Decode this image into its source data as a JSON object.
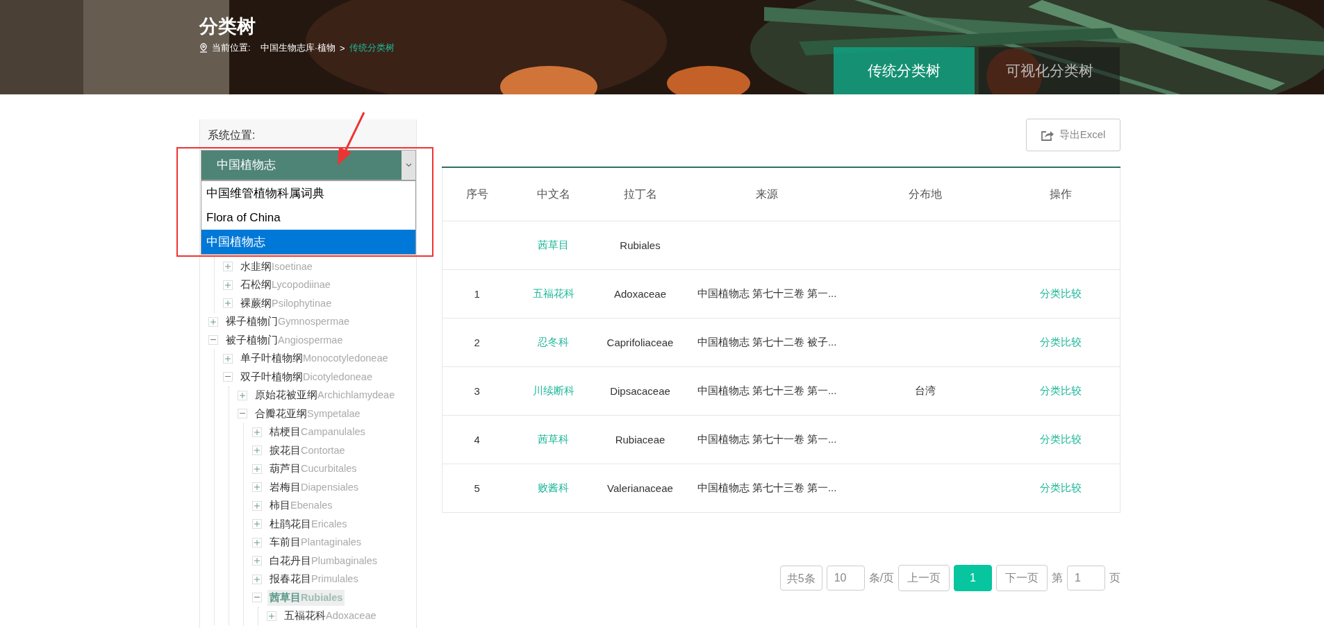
{
  "header": {
    "title": "分类树",
    "breadcrumb": {
      "label": "当前位置:",
      "path": "中国生物志库·植物",
      "separator": ">",
      "current": "传统分类树"
    },
    "tabs": [
      {
        "label": "传统分类树",
        "selected": true
      },
      {
        "label": "可视化分类树",
        "selected": false
      }
    ]
  },
  "sidebar": {
    "label": "系统位置:",
    "select": {
      "value": "中国植物志",
      "options": [
        {
          "label": "中国维管植物科属词典",
          "selected": false
        },
        {
          "label": "Flora of China",
          "selected": false
        },
        {
          "label": "中国植物志",
          "selected": true
        }
      ]
    },
    "tree": [
      {
        "children": [
          {
            "name": "水韭纲",
            "latin": "Isoetinae",
            "expanded": false,
            "selected": false
          },
          {
            "name": "石松纲",
            "latin": "Lycopodiinae",
            "expanded": false,
            "selected": false
          },
          {
            "name": "裸蕨纲",
            "latin": "Psilophytinae",
            "expanded": false,
            "selected": false
          }
        ]
      },
      {
        "name": "裸子植物门",
        "latin": "Gymnospermae",
        "expanded": false,
        "selected": false
      },
      {
        "name": "被子植物门",
        "latin": "Angiospermae",
        "expanded": true,
        "selected": false,
        "children": [
          {
            "name": "单子叶植物纲",
            "latin": "Monocotyledoneae",
            "expanded": false,
            "selected": false
          },
          {
            "name": "双子叶植物纲",
            "latin": "Dicotyledoneae",
            "expanded": true,
            "selected": false,
            "children": [
              {
                "name": "原始花被亚纲",
                "latin": "Archichlamydeae",
                "expanded": false,
                "selected": false
              },
              {
                "name": "合瓣花亚纲",
                "latin": "Sympetalae",
                "expanded": true,
                "selected": false,
                "children": [
                  {
                    "name": "桔梗目",
                    "latin": "Campanulales",
                    "expanded": false,
                    "selected": false
                  },
                  {
                    "name": "捩花目",
                    "latin": "Contortae",
                    "expanded": false,
                    "selected": false
                  },
                  {
                    "name": "葫芦目",
                    "latin": "Cucurbitales",
                    "expanded": false,
                    "selected": false
                  },
                  {
                    "name": "岩梅目",
                    "latin": "Diapensiales",
                    "expanded": false,
                    "selected": false
                  },
                  {
                    "name": "柿目",
                    "latin": "Ebenales",
                    "expanded": false,
                    "selected": false
                  },
                  {
                    "name": "杜鹃花目",
                    "latin": "Ericales",
                    "expanded": false,
                    "selected": false
                  },
                  {
                    "name": "车前目",
                    "latin": "Plantaginales",
                    "expanded": false,
                    "selected": false
                  },
                  {
                    "name": "白花丹目",
                    "latin": "Plumbaginales",
                    "expanded": false,
                    "selected": false
                  },
                  {
                    "name": "报春花目",
                    "latin": "Primulales",
                    "expanded": false,
                    "selected": false
                  },
                  {
                    "name": "茜草目",
                    "latin": "Rubiales",
                    "expanded": true,
                    "selected": true,
                    "children": [
                      {
                        "name": "五福花科",
                        "latin": "Adoxaceae",
                        "expanded": false,
                        "selected": false
                      }
                    ]
                  }
                ]
              }
            ]
          }
        ]
      }
    ]
  },
  "export_button": "导出Excel",
  "table": {
    "columns": [
      "序号",
      "中文名",
      "拉丁名",
      "来源",
      "分布地",
      "操作"
    ],
    "rows": [
      {
        "name": "茜草目",
        "latin": "Rubiales"
      },
      {
        "index": "1",
        "name": "五福花科",
        "latin": "Adoxaceae",
        "source": "中国植物志 第七十三卷 第一...",
        "action": "分类比较"
      },
      {
        "index": "2",
        "name": "忍冬科",
        "latin": "Caprifoliaceae",
        "source": "中国植物志 第七十二卷 被子...",
        "action": "分类比较"
      },
      {
        "index": "3",
        "name": "川续断科",
        "latin": "Dipsacaceae",
        "source": "中国植物志 第七十三卷 第一...",
        "distribution": "台湾",
        "action": "分类比较"
      },
      {
        "index": "4",
        "name": "茜草科",
        "latin": "Rubiaceae",
        "source": "中国植物志 第七十一卷 第一...",
        "action": "分类比较"
      },
      {
        "index": "5",
        "name": "败酱科",
        "latin": "Valerianaceae",
        "source": "中国植物志 第七十三卷 第一...",
        "action": "分类比较"
      }
    ]
  },
  "pagination": {
    "total": "共5条",
    "page_size": "10",
    "per_page_label": "条/页",
    "prev": "上一页",
    "pages": [
      {
        "label": "1",
        "selected": true
      }
    ],
    "next": "下一页",
    "goto_prefix": "第",
    "goto_value": "1",
    "goto_suffix": "页"
  }
}
